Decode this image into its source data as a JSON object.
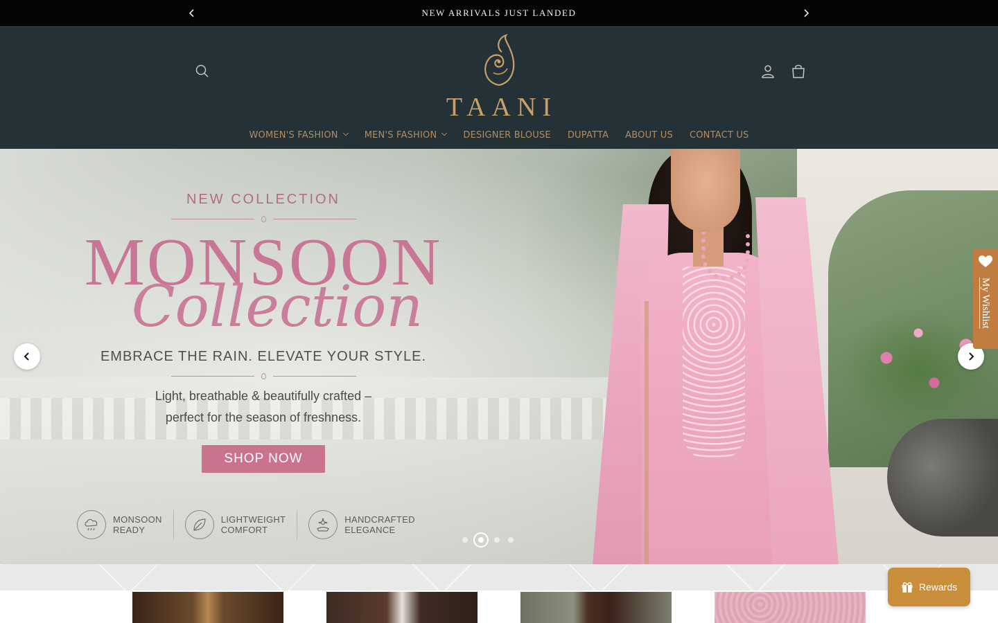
{
  "announcement": {
    "text": "NEW ARRIVALS JUST LANDED"
  },
  "header": {
    "logo_text": "TAANI",
    "nav": [
      {
        "label": "WOMEN'S FASHION",
        "has_dropdown": true
      },
      {
        "label": "MEN'S FASHION",
        "has_dropdown": true
      },
      {
        "label": "DESIGNER BLOUSE",
        "has_dropdown": false
      },
      {
        "label": "DUPATTA",
        "has_dropdown": false
      },
      {
        "label": "ABOUT US",
        "has_dropdown": false
      },
      {
        "label": "CONTACT US",
        "has_dropdown": false
      }
    ],
    "icons": [
      "search-icon",
      "account-icon",
      "cart-icon"
    ]
  },
  "hero": {
    "eyebrow": "NEW COLLECTION",
    "title": "MONSOON",
    "script": "Collection",
    "tagline": "EMBRACE THE RAIN. ELEVATE YOUR STYLE.",
    "sub_line1": "Light, breathable & beautifully crafted –",
    "sub_line2": "perfect for the season of freshness.",
    "cta": "SHOP NOW",
    "features": [
      {
        "line1": "MONSOON",
        "line2": "READY",
        "icon": "cloud-rain-icon"
      },
      {
        "line1": "LIGHTWEIGHT",
        "line2": "COMFORT",
        "icon": "leaf-icon"
      },
      {
        "line1": "HANDCRAFTED",
        "line2": "ELEGANCE",
        "icon": "flower-icon"
      }
    ],
    "slide_count": 4,
    "active_slide": 2
  },
  "wishlist": {
    "label": "My Wishlist"
  },
  "rewards": {
    "label": "Rewards"
  },
  "colors": {
    "header_bg": "#243237",
    "nav_text": "#b58a5e",
    "logo_gold": "#c8a06a",
    "hero_pink": "#c97596",
    "wishlist_bg": "#c17d40",
    "rewards_bg": "#c88e3a"
  }
}
